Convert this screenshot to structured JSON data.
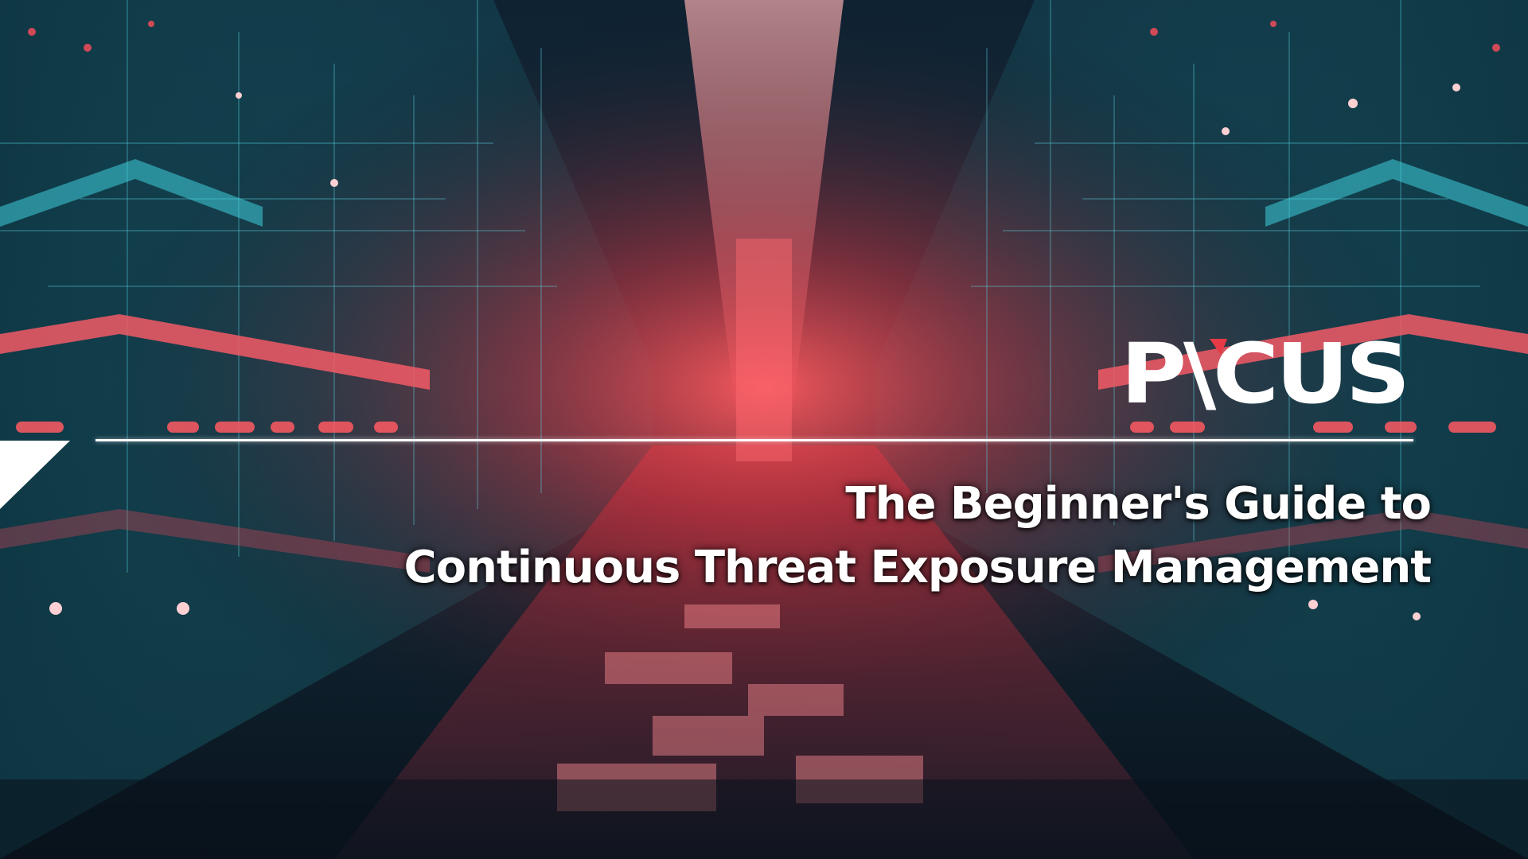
{
  "brand": {
    "logo_text": "PICUS",
    "accent_color": "#e63a46",
    "logo_color": "#ffffff"
  },
  "headline": {
    "line1": "The Beginner's Guide to",
    "line2": "Continuous Threat Exposure Management"
  },
  "background": {
    "description_colors": [
      "#e8404d",
      "#2fb6c6",
      "#0b1622"
    ]
  }
}
